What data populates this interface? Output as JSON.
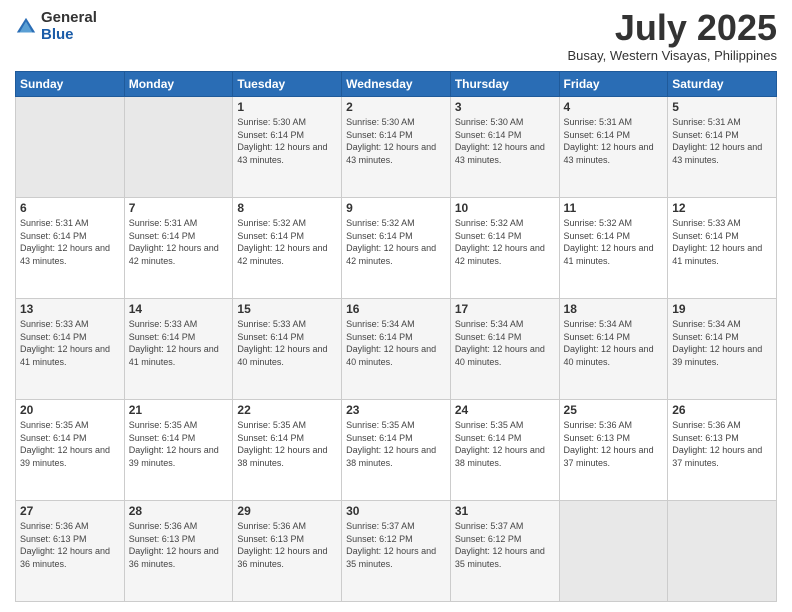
{
  "logo": {
    "general": "General",
    "blue": "Blue"
  },
  "header": {
    "month": "July 2025",
    "location": "Busay, Western Visayas, Philippines"
  },
  "weekdays": [
    "Sunday",
    "Monday",
    "Tuesday",
    "Wednesday",
    "Thursday",
    "Friday",
    "Saturday"
  ],
  "weeks": [
    [
      {
        "day": "",
        "info": ""
      },
      {
        "day": "",
        "info": ""
      },
      {
        "day": "1",
        "info": "Sunrise: 5:30 AM\nSunset: 6:14 PM\nDaylight: 12 hours and 43 minutes."
      },
      {
        "day": "2",
        "info": "Sunrise: 5:30 AM\nSunset: 6:14 PM\nDaylight: 12 hours and 43 minutes."
      },
      {
        "day": "3",
        "info": "Sunrise: 5:30 AM\nSunset: 6:14 PM\nDaylight: 12 hours and 43 minutes."
      },
      {
        "day": "4",
        "info": "Sunrise: 5:31 AM\nSunset: 6:14 PM\nDaylight: 12 hours and 43 minutes."
      },
      {
        "day": "5",
        "info": "Sunrise: 5:31 AM\nSunset: 6:14 PM\nDaylight: 12 hours and 43 minutes."
      }
    ],
    [
      {
        "day": "6",
        "info": "Sunrise: 5:31 AM\nSunset: 6:14 PM\nDaylight: 12 hours and 43 minutes."
      },
      {
        "day": "7",
        "info": "Sunrise: 5:31 AM\nSunset: 6:14 PM\nDaylight: 12 hours and 42 minutes."
      },
      {
        "day": "8",
        "info": "Sunrise: 5:32 AM\nSunset: 6:14 PM\nDaylight: 12 hours and 42 minutes."
      },
      {
        "day": "9",
        "info": "Sunrise: 5:32 AM\nSunset: 6:14 PM\nDaylight: 12 hours and 42 minutes."
      },
      {
        "day": "10",
        "info": "Sunrise: 5:32 AM\nSunset: 6:14 PM\nDaylight: 12 hours and 42 minutes."
      },
      {
        "day": "11",
        "info": "Sunrise: 5:32 AM\nSunset: 6:14 PM\nDaylight: 12 hours and 41 minutes."
      },
      {
        "day": "12",
        "info": "Sunrise: 5:33 AM\nSunset: 6:14 PM\nDaylight: 12 hours and 41 minutes."
      }
    ],
    [
      {
        "day": "13",
        "info": "Sunrise: 5:33 AM\nSunset: 6:14 PM\nDaylight: 12 hours and 41 minutes."
      },
      {
        "day": "14",
        "info": "Sunrise: 5:33 AM\nSunset: 6:14 PM\nDaylight: 12 hours and 41 minutes."
      },
      {
        "day": "15",
        "info": "Sunrise: 5:33 AM\nSunset: 6:14 PM\nDaylight: 12 hours and 40 minutes."
      },
      {
        "day": "16",
        "info": "Sunrise: 5:34 AM\nSunset: 6:14 PM\nDaylight: 12 hours and 40 minutes."
      },
      {
        "day": "17",
        "info": "Sunrise: 5:34 AM\nSunset: 6:14 PM\nDaylight: 12 hours and 40 minutes."
      },
      {
        "day": "18",
        "info": "Sunrise: 5:34 AM\nSunset: 6:14 PM\nDaylight: 12 hours and 40 minutes."
      },
      {
        "day": "19",
        "info": "Sunrise: 5:34 AM\nSunset: 6:14 PM\nDaylight: 12 hours and 39 minutes."
      }
    ],
    [
      {
        "day": "20",
        "info": "Sunrise: 5:35 AM\nSunset: 6:14 PM\nDaylight: 12 hours and 39 minutes."
      },
      {
        "day": "21",
        "info": "Sunrise: 5:35 AM\nSunset: 6:14 PM\nDaylight: 12 hours and 39 minutes."
      },
      {
        "day": "22",
        "info": "Sunrise: 5:35 AM\nSunset: 6:14 PM\nDaylight: 12 hours and 38 minutes."
      },
      {
        "day": "23",
        "info": "Sunrise: 5:35 AM\nSunset: 6:14 PM\nDaylight: 12 hours and 38 minutes."
      },
      {
        "day": "24",
        "info": "Sunrise: 5:35 AM\nSunset: 6:14 PM\nDaylight: 12 hours and 38 minutes."
      },
      {
        "day": "25",
        "info": "Sunrise: 5:36 AM\nSunset: 6:13 PM\nDaylight: 12 hours and 37 minutes."
      },
      {
        "day": "26",
        "info": "Sunrise: 5:36 AM\nSunset: 6:13 PM\nDaylight: 12 hours and 37 minutes."
      }
    ],
    [
      {
        "day": "27",
        "info": "Sunrise: 5:36 AM\nSunset: 6:13 PM\nDaylight: 12 hours and 36 minutes."
      },
      {
        "day": "28",
        "info": "Sunrise: 5:36 AM\nSunset: 6:13 PM\nDaylight: 12 hours and 36 minutes."
      },
      {
        "day": "29",
        "info": "Sunrise: 5:36 AM\nSunset: 6:13 PM\nDaylight: 12 hours and 36 minutes."
      },
      {
        "day": "30",
        "info": "Sunrise: 5:37 AM\nSunset: 6:12 PM\nDaylight: 12 hours and 35 minutes."
      },
      {
        "day": "31",
        "info": "Sunrise: 5:37 AM\nSunset: 6:12 PM\nDaylight: 12 hours and 35 minutes."
      },
      {
        "day": "",
        "info": ""
      },
      {
        "day": "",
        "info": ""
      }
    ]
  ]
}
